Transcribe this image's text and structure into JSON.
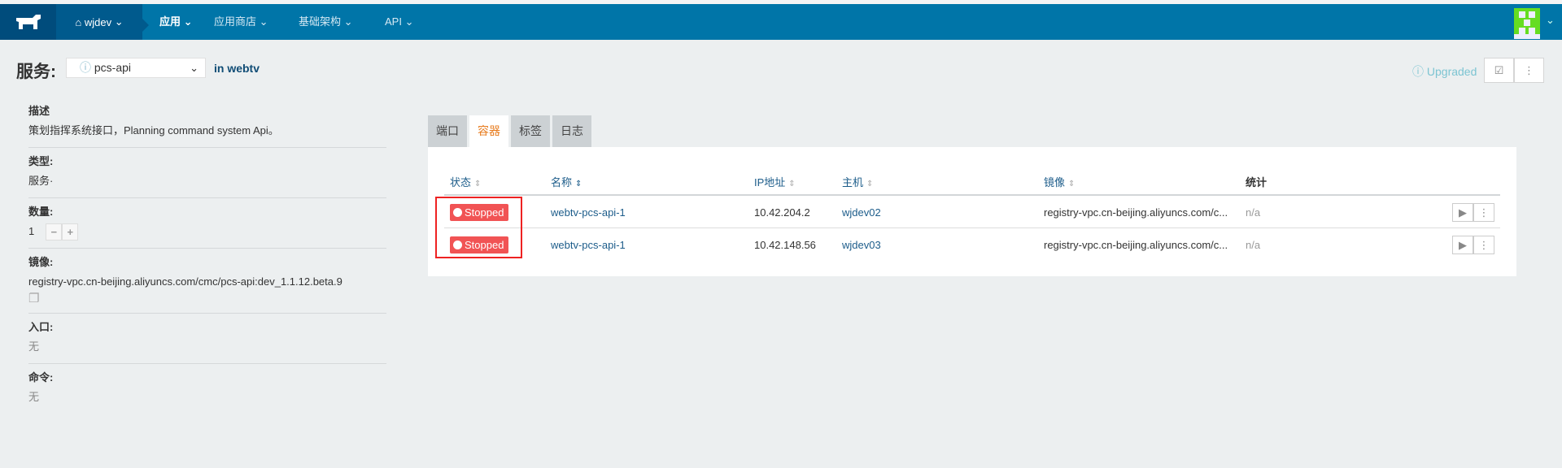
{
  "nav": {
    "env": "wjdev",
    "items": [
      {
        "label": "应用",
        "active": true
      },
      {
        "label": "应用商店"
      },
      {
        "label": "基础架构"
      },
      {
        "label": "API"
      }
    ]
  },
  "header": {
    "label": "服务:",
    "service": "pcs-api",
    "in_text": "in webtv",
    "status": "Upgraded"
  },
  "details": [
    {
      "label": "描述",
      "value": "策划指挥系统接口，Planning command system Api。"
    },
    {
      "label": "类型:",
      "value": "服务·"
    },
    {
      "label": "数量:",
      "value": "1"
    },
    {
      "label": "镜像:",
      "value": "registry-vpc.cn-beijing.aliyuncs.com/cmc/pcs-api:dev_1.1.12.beta.9"
    },
    {
      "label": "入口:",
      "value": "无"
    },
    {
      "label": "命令:",
      "value": "无"
    }
  ],
  "tabs": [
    "端口",
    "容器",
    "标签",
    "日志"
  ],
  "table": {
    "headers": [
      "状态",
      "名称",
      "IP地址",
      "主机",
      "镜像",
      "统计"
    ],
    "rows": [
      {
        "state": "Stopped",
        "name": "webtv-pcs-api-1",
        "ip": "10.42.204.2",
        "host": "wjdev02",
        "image": "registry-vpc.cn-beijing.aliyuncs.com/c...",
        "stats": "n/a"
      },
      {
        "state": "Stopped",
        "name": "webtv-pcs-api-1",
        "ip": "10.42.148.56",
        "host": "wjdev03",
        "image": "registry-vpc.cn-beijing.aliyuncs.com/c...",
        "stats": "n/a"
      }
    ]
  }
}
